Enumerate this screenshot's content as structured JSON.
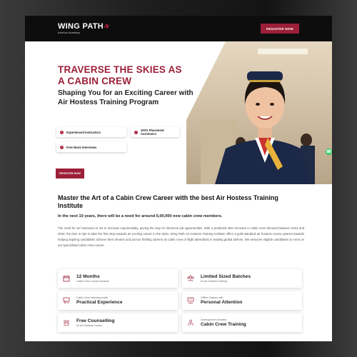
{
  "nav": {
    "logo_text": "WING PATH",
    "logo_sub": "Aviation Academy",
    "register_label": "REGISTER NOW"
  },
  "hero": {
    "title": "TRAVERSE THE SKIES AS A CABIN CREW",
    "subtitle": "Shaping You for an Exciting Career with Air Hostess Training Program",
    "features": [
      "Experienced Instructors",
      "100% Placement Assistance",
      "Free Mock Interviews"
    ],
    "cta_label": "REGISTER NOW"
  },
  "content": {
    "title": "Master the Art of a Cabin Crew Career with the best Air Hostess Training Institute",
    "lead": "In the next 10 years, there will be a need for around 6,00,000 new cabin crew members.",
    "paragraph": "The need for air hostesses is set to increase exponentially, paving the way for immense job opportunities. With a predicted 45% increase in cabin crew demand between 2023 and 2032, the time is ripe to take the first step towards an exciting career in the skies. Wing Path Air Hostess Training Institute offers a gold-standard air hostess course geared towards helping aspiring candidates achieve their dreams and pursue thrilling careers as cabin crew or flight attendants in leading global airlines. We welcome eligible candidates to enrol on our specialised cabin crew course."
  },
  "cards": [
    {
      "top": "",
      "big": "12 Months",
      "small": "Cabin Crew Course Duration",
      "icon": "calendar-icon"
    },
    {
      "top": "",
      "big": "Limited Sized Batches",
      "small": "for Air Hostess Training",
      "icon": "group-icon"
    },
    {
      "top": "Cabin Crew Instructors with",
      "big": "Practical Experience",
      "small": "",
      "icon": "instructor-icon"
    },
    {
      "top": "Offline Classes with",
      "big": "Personal Attention",
      "small": "",
      "icon": "classroom-icon"
    },
    {
      "top": "",
      "big": "Free Counselling",
      "small": "for Air Hostess Course",
      "icon": "counselling-icon"
    },
    {
      "top": "Development Oriented",
      "big": "Cabin Crew Training",
      "small": "",
      "icon": "training-icon"
    }
  ],
  "colors": {
    "brand": "#9c1f38",
    "nav_bg": "#0d0d0d",
    "whatsapp": "#25d366"
  }
}
